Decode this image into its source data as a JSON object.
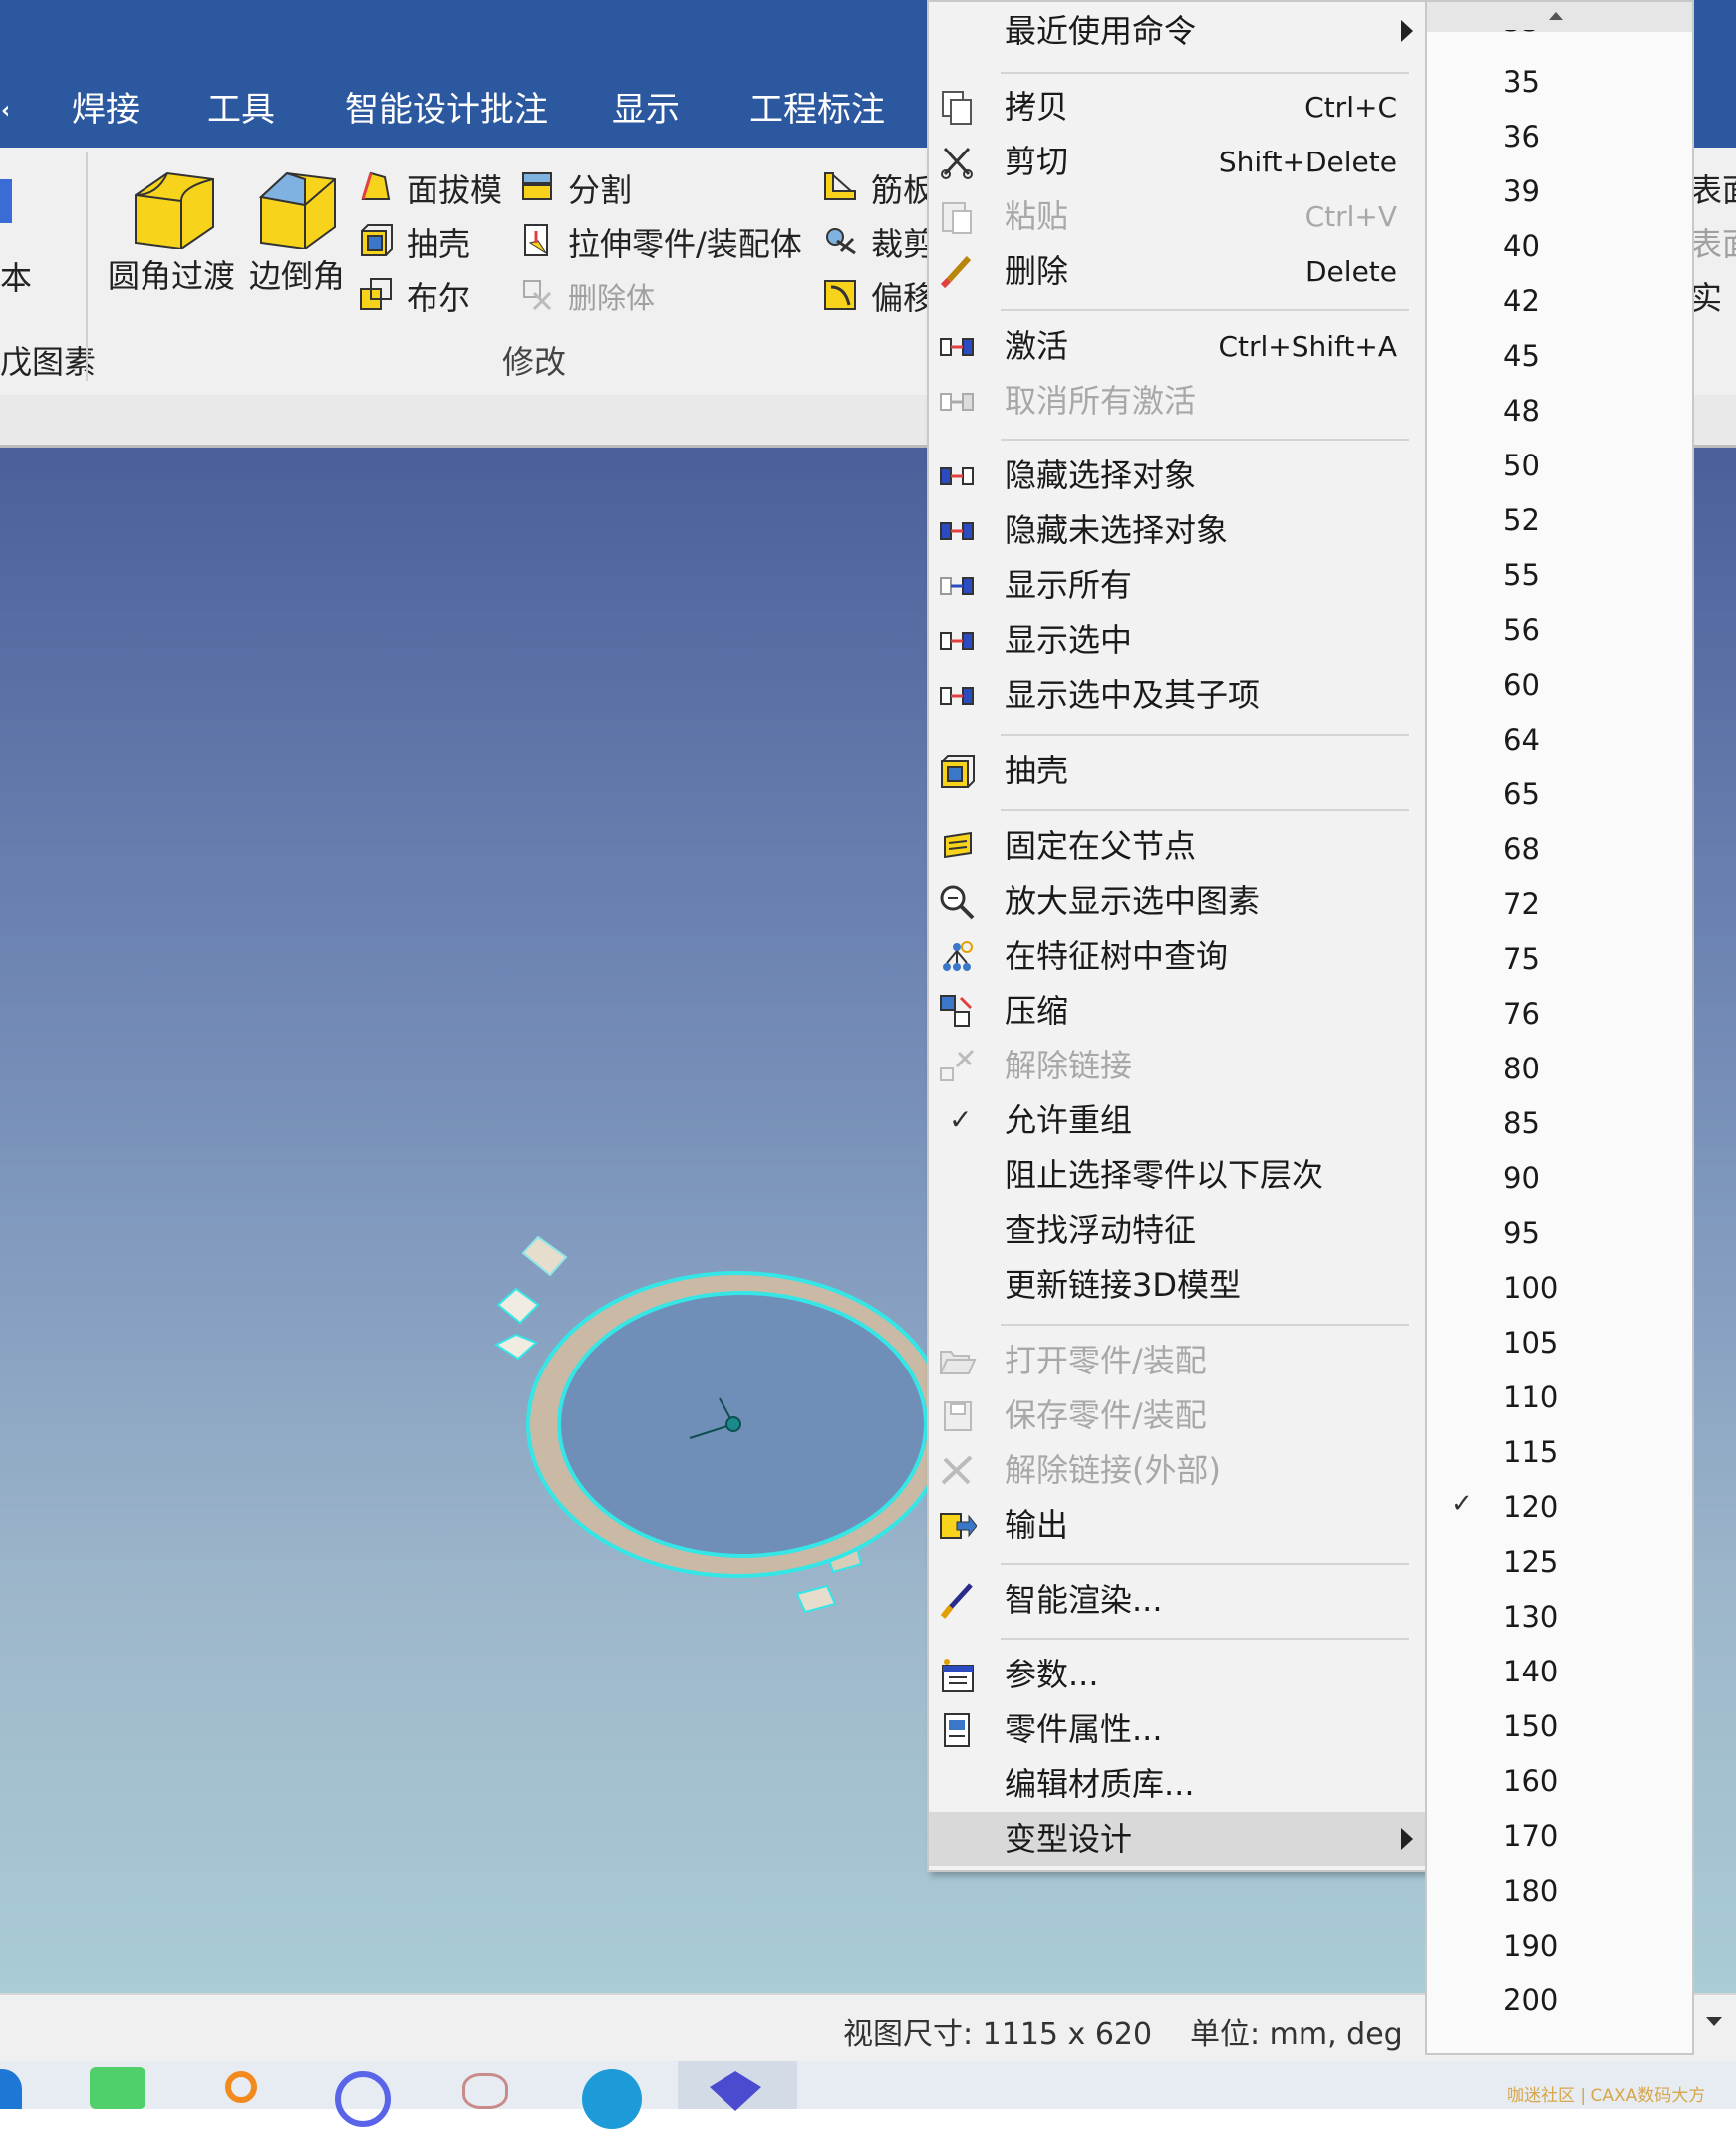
{
  "menu_tabs": [
    "焊接",
    "工具",
    "智能设计批注",
    "显示",
    "工程标注"
  ],
  "ribbon": {
    "left_partial_label": "本",
    "left_partial_group": "戊图素",
    "fillet_label": "圆角过渡",
    "chamfer_label": "边倒角",
    "draft_label": "面拔模",
    "shell_label": "抽壳",
    "boolean_label": "布尔",
    "split_label": "分割",
    "extrude_part_label": "拉伸零件/装配体",
    "delete_body_label": "删除体",
    "rib_label": "筋板",
    "trim_label": "裁剪",
    "offset_label": "偏移",
    "group_modify": "修改",
    "right_partial_1": "表面",
    "right_partial_2": "表面",
    "right_partial_3": "实"
  },
  "context_menu": {
    "recent": "最近使用命令",
    "copy": {
      "label": "拷贝",
      "shortcut": "Ctrl+C"
    },
    "cut": {
      "label": "剪切",
      "shortcut": "Shift+Delete"
    },
    "paste": {
      "label": "粘贴",
      "shortcut": "Ctrl+V"
    },
    "delete": {
      "label": "删除",
      "shortcut": "Delete"
    },
    "activate": {
      "label": "激活",
      "shortcut": "Ctrl+Shift+A"
    },
    "deactivate_all": "取消所有激活",
    "hide_selected": "隐藏选择对象",
    "hide_unselected": "隐藏未选择对象",
    "show_all": "显示所有",
    "show_selected": "显示选中",
    "show_selected_children": "显示选中及其子项",
    "shell": "抽壳",
    "fix_parent": "固定在父节点",
    "zoom_selected": "放大显示选中图素",
    "find_in_tree": "在特征树中查询",
    "compress": "压缩",
    "unlink": "解除链接",
    "allow_regroup": "允许重组",
    "block_select": "阻止选择零件以下层次",
    "find_floating": "查找浮动特征",
    "update_link": "更新链接3D模型",
    "open_part": "打开零件/装配",
    "save_part": "保存零件/装配",
    "unlink_external": "解除链接(外部)",
    "export": "输出",
    "smart_render": "智能渲染...",
    "parameters": "参数...",
    "part_properties": "零件属性...",
    "edit_material": "编辑材质库...",
    "variant_design": "变型设计"
  },
  "size_list": {
    "items": [
      "35",
      "36",
      "39",
      "40",
      "42",
      "45",
      "48",
      "50",
      "52",
      "55",
      "56",
      "60",
      "64",
      "65",
      "68",
      "72",
      "75",
      "76",
      "80",
      "85",
      "90",
      "95",
      "100",
      "105",
      "110",
      "115",
      "120",
      "125",
      "130",
      "140",
      "150",
      "160",
      "170",
      "180",
      "190",
      "200"
    ],
    "checked": "120"
  },
  "status": {
    "view_size": "视图尺寸: 1115 x  620",
    "units": "单位: mm, deg"
  },
  "watermark": "咖迷社区 | CAXA数码大方",
  "colors": {
    "titlebar": "#2c58a0",
    "selection_cyan": "#35e6e6",
    "ring": "#c9b9a5"
  }
}
